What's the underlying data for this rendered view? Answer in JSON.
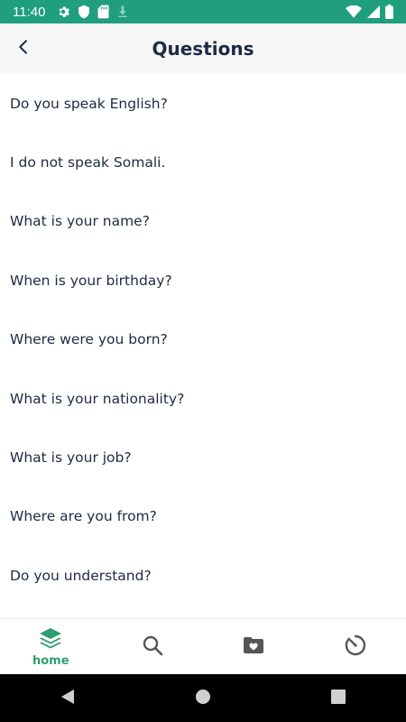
{
  "status_bar": {
    "time": "11:40",
    "icons": [
      "gear-icon",
      "shield-icon",
      "sd-card-icon",
      "download-icon",
      "wifi-icon",
      "signal-icon",
      "battery-icon"
    ],
    "color": "#1f9f7e"
  },
  "app_bar": {
    "title": "Questions",
    "back_icon": "chevron-left-icon"
  },
  "questions": [
    "Do you speak English?",
    "I do not speak Somali.",
    "What is your name?",
    "When is your birthday?",
    "Where were you born?",
    "What is your nationality?",
    "What is your job?",
    "Where are you from?",
    "Do you understand?"
  ],
  "bottom_nav": {
    "items": [
      {
        "name": "home",
        "label": "home",
        "icon": "layers-icon",
        "active": true
      },
      {
        "name": "search",
        "label": "",
        "icon": "search-icon",
        "active": false
      },
      {
        "name": "favorites",
        "label": "",
        "icon": "folder-heart-icon",
        "active": false
      },
      {
        "name": "history",
        "label": "",
        "icon": "timer-icon",
        "active": false
      }
    ],
    "active_color": "#2f9e6f",
    "inactive_color": "#555555"
  },
  "system_nav": {
    "buttons": [
      "back-triangle-icon",
      "home-circle-icon",
      "recents-square-icon"
    ]
  }
}
